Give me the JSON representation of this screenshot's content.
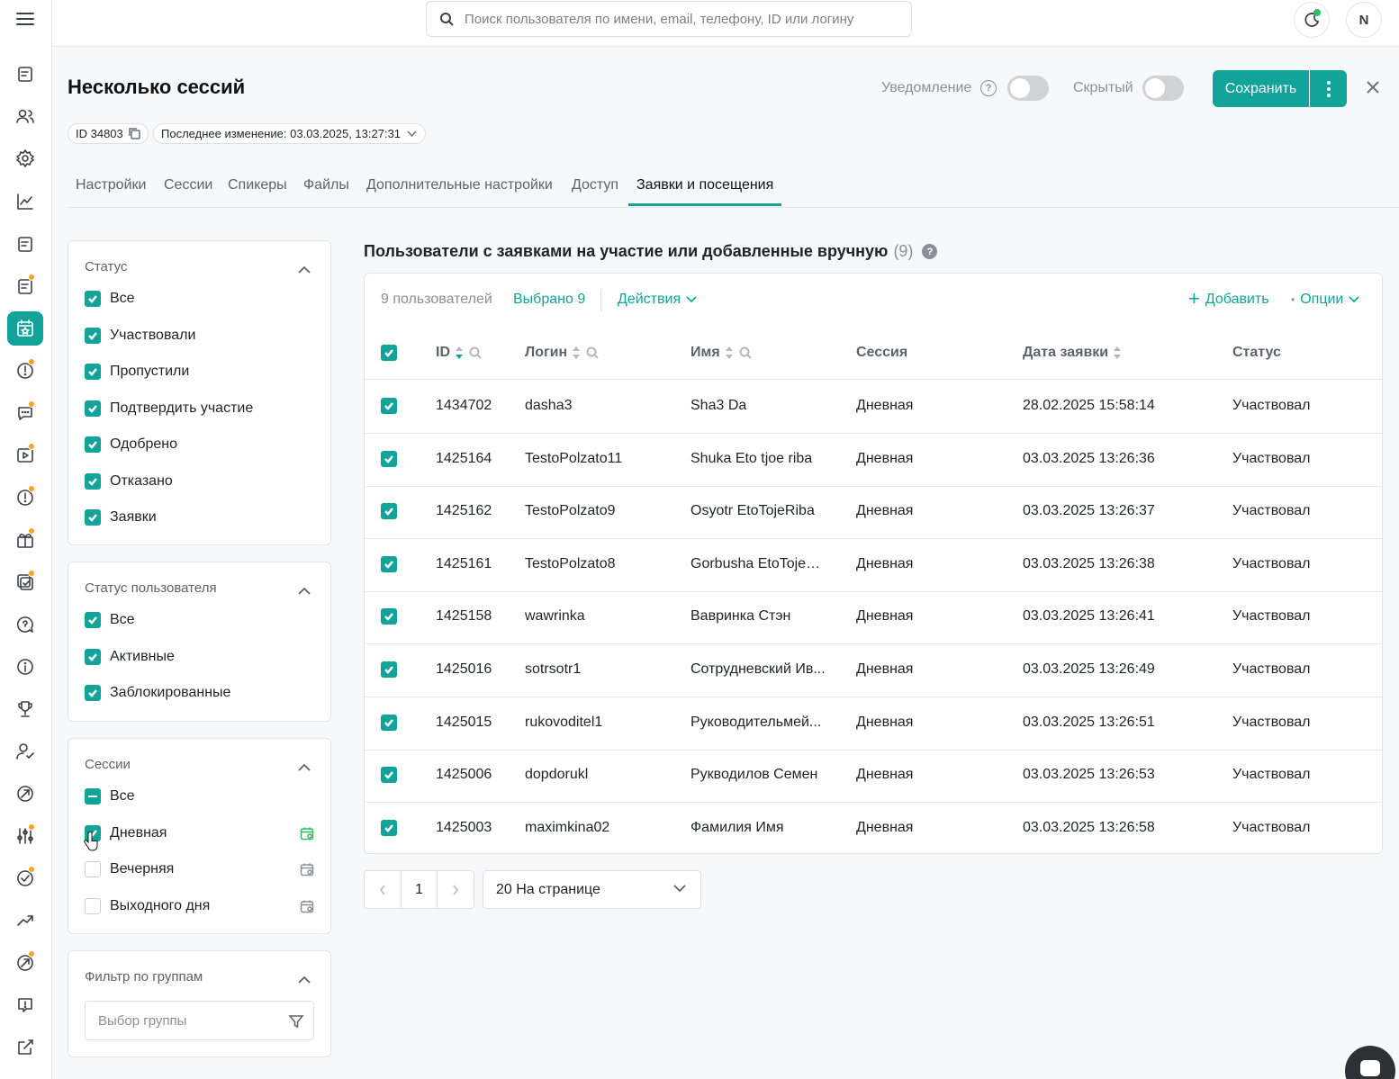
{
  "topbar": {
    "search_placeholder": "Поиск пользователя по имени, email, телефону, ID или логину",
    "avatar_initial": "N"
  },
  "sidebar": {
    "icons": [
      "news-icon",
      "users-icon",
      "settings-icon",
      "analytics-icon",
      "articles-icon",
      "documents-icon",
      "events-icon",
      "alerts-icon",
      "chat-icon",
      "video-icon",
      "alerts-2-icon",
      "gift-icon",
      "tasks-icon",
      "questions-icon",
      "info-icon",
      "trophy-icon",
      "user-check-icon",
      "compass-icon",
      "sliders-icon",
      "check-circle-icon",
      "trend-icon",
      "target-icon",
      "feedback-icon",
      "external-link-icon"
    ],
    "active_index": 6
  },
  "header": {
    "title": "Несколько сессий",
    "notification_label": "Уведомление",
    "hidden_label": "Скрытый",
    "save_label": "Сохранить",
    "id_chip": "ID 34803",
    "last_modified": "Последнее изменение: 03.03.2025, 13:27:31"
  },
  "tabs": [
    "Настройки",
    "Сессии",
    "Спикеры",
    "Файлы",
    "Дополнительные настройки",
    "Доступ",
    "Заявки и посещения"
  ],
  "active_tab": "Заявки и посещения",
  "filters": {
    "status": {
      "title": "Статус",
      "options": [
        "Все",
        "Участвовали",
        "Пропустили",
        "Подтвердить участие",
        "Одобрено",
        "Отказано",
        "Заявки"
      ]
    },
    "user_status": {
      "title": "Статус пользователя",
      "options": [
        "Все",
        "Активные",
        "Заблокированные"
      ]
    },
    "sessions": {
      "title": "Сессии",
      "options": [
        "Все",
        "Дневная",
        "Вечерняя",
        "Выходного дня"
      ]
    },
    "groups": {
      "title": "Фильтр по группам",
      "placeholder": "Выбор группы"
    }
  },
  "main": {
    "section_title": "Пользователи с заявками на участие или добавленные вручную",
    "section_count": "(9)",
    "users_count": "9 пользователей",
    "selected": "Выбрано 9",
    "actions": "Действия",
    "add": "Добавить",
    "options": "Опции",
    "columns": [
      "ID",
      "Логин",
      "Имя",
      "Сессия",
      "Дата заявки",
      "Статус"
    ],
    "rows": [
      [
        "1434702",
        "dasha3",
        "Sha3 Da",
        "Дневная",
        "28.02.2025 15:58:14",
        "Участвовал"
      ],
      [
        "1425164",
        "TestoPolzato11",
        "Shuka Eto tjoe riba",
        "Дневная",
        "03.03.2025 13:26:36",
        "Участвовал"
      ],
      [
        "1425162",
        "TestoPolzato9",
        "Osyotr EtoTojeRiba",
        "Дневная",
        "03.03.2025 13:26:37",
        "Участвовал"
      ],
      [
        "1425161",
        "TestoPolzato8",
        "Gorbusha EtoTojeR...",
        "Дневная",
        "03.03.2025 13:26:38",
        "Участвовал"
      ],
      [
        "1425158",
        "wawrinka",
        "Вавринка Стэн",
        "Дневная",
        "03.03.2025 13:26:41",
        "Участвовал"
      ],
      [
        "1425016",
        "sotrsotr1",
        "Сотрудневский Ив...",
        "Дневная",
        "03.03.2025 13:26:49",
        "Участвовал"
      ],
      [
        "1425015",
        "rukovoditel1",
        "Руководительмей...",
        "Дневная",
        "03.03.2025 13:26:51",
        "Участвовал"
      ],
      [
        "1425006",
        "dopdorukl",
        "Рукводилов Семен",
        "Дневная",
        "03.03.2025 13:26:53",
        "Участвовал"
      ],
      [
        "1425003",
        "maximkina02",
        "Фамилия Имя",
        "Дневная",
        "03.03.2025 13:26:58",
        "Участвовал"
      ]
    ]
  },
  "pagination": {
    "page": "1",
    "per_page": "20 На странице"
  },
  "colors": {
    "accent": "#12a39a",
    "badge": "#f5a623"
  }
}
